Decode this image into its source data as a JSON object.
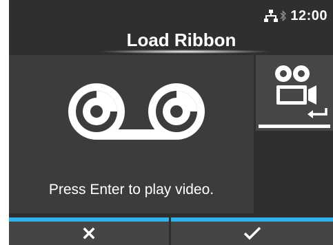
{
  "status": {
    "network_icon": "network-icon",
    "bluetooth_icon": "bluetooth-icon",
    "time": "12:00"
  },
  "header": {
    "title": "Load Ribbon"
  },
  "main": {
    "illustration_icon": "ribbon-icon",
    "instruction": "Press Enter to play video."
  },
  "video_button": {
    "icon": "video-camera-icon",
    "enter_icon": "enter-icon",
    "selected": true
  },
  "softkeys": {
    "cancel_icon": "close-icon",
    "confirm_icon": "checkmark-icon"
  },
  "colors": {
    "background": "#2f2f2f",
    "panel": "#3c3c3c",
    "button": "#464646",
    "accent": "#2fb3e8",
    "text": "#ffffff"
  }
}
